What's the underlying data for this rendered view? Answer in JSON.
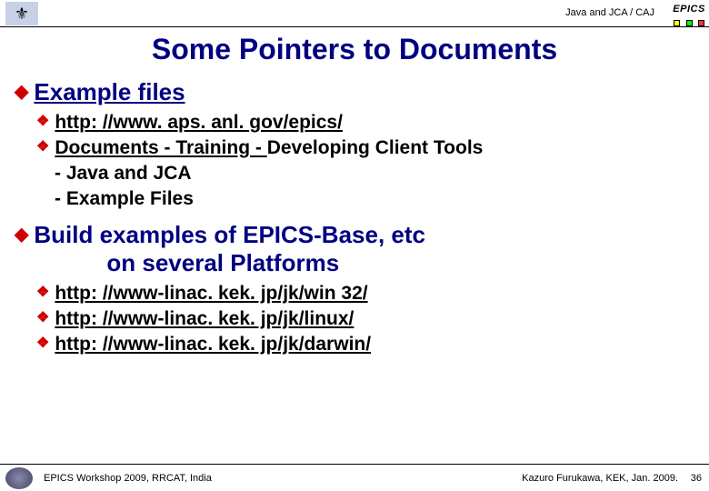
{
  "header": {
    "breadcrumb": "Java and JCA / CAJ",
    "logo_text": "EPICS"
  },
  "title": "Some Pointers to Documents",
  "sections": [
    {
      "heading": "Example files",
      "heading_underline": true,
      "items": [
        {
          "text": "http: //www. aps. anl. gov/epics/",
          "link": true
        },
        {
          "text_parts": [
            "Documents - Training - ",
            "Developing Client Tools"
          ],
          "link_first": true
        },
        {
          "plain": "- Java and JCA"
        },
        {
          "plain": "- Example Files"
        }
      ]
    },
    {
      "heading_lines": [
        "Build examples of EPICS-Base, etc",
        "on several Platforms"
      ],
      "items": [
        {
          "text": "http: //www-linac. kek. jp/jk/win 32/",
          "link": true
        },
        {
          "text": "http: //www-linac. kek. jp/jk/linux/",
          "link": true
        },
        {
          "text": "http: //www-linac. kek. jp/jk/darwin/",
          "link": true
        }
      ]
    }
  ],
  "footer": {
    "left": "EPICS Workshop 2009, RRCAT, India",
    "right": "Kazuro Furukawa, KEK, Jan. 2009.",
    "page": "36"
  }
}
